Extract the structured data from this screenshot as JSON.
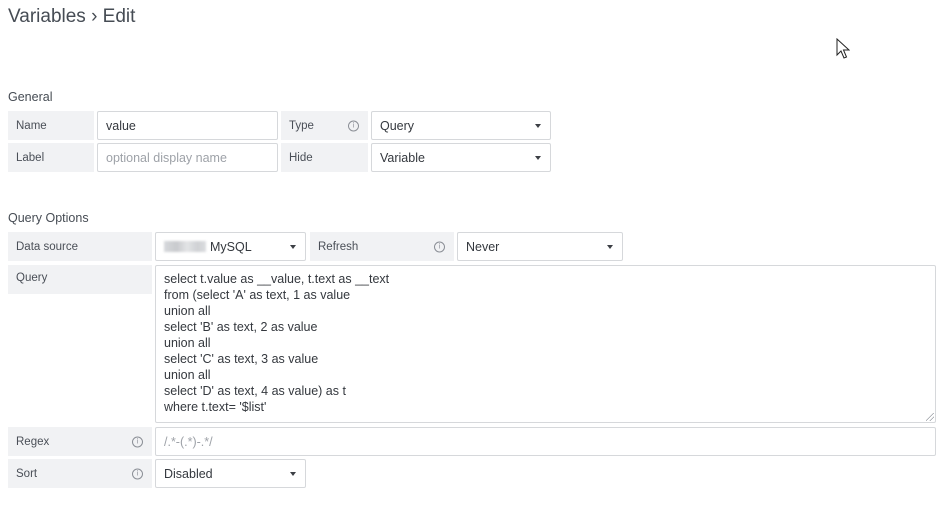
{
  "header": {
    "title": "Variables › Edit"
  },
  "general": {
    "title": "General",
    "name_label": "Name",
    "name_value": "value",
    "type_label": "Type",
    "type_value": "Query",
    "label_label": "Label",
    "label_placeholder": "optional display name",
    "hide_label": "Hide",
    "hide_value": "Variable"
  },
  "query_options": {
    "title": "Query Options",
    "datasource_label": "Data source",
    "datasource_value": "MySQL",
    "refresh_label": "Refresh",
    "refresh_value": "Never",
    "query_label": "Query",
    "query_lines": [
      "select t.value as __value, t.text as __text",
      "from (select 'A' as text, 1 as value",
      "union all",
      "select 'B' as text, 2 as value",
      "union all",
      "select 'C' as text, 3 as value",
      "union all",
      "select 'D' as text, 4 as value) as t",
      "where t.text= '$list'"
    ],
    "regex_label": "Regex",
    "regex_placeholder": "/.*-(.*)-.*/",
    "sort_label": "Sort",
    "sort_value": "Disabled"
  },
  "icons": {
    "info": "info-circle-icon",
    "dropdown": "caret-down-icon",
    "cursor": "mouse-pointer-icon"
  },
  "colors": {
    "label_bg": "#f1f2f4",
    "input_border": "#d6d8db",
    "text": "#34383e"
  }
}
